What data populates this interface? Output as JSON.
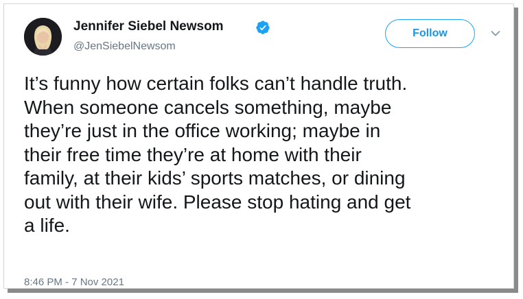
{
  "author": {
    "display_name": "Jennifer Siebel Newsom",
    "handle": "@JenSiebelNewsom",
    "verified": true,
    "avatar_icon": "profile-photo"
  },
  "actions": {
    "follow_label": "Follow",
    "more_icon": "chevron-down-icon"
  },
  "tweet": {
    "lines": [
      "It’s funny how certain folks can’t handle truth.",
      "When someone cancels something, maybe",
      "they’re just in the office working; maybe in",
      "their free time they’re at home with their",
      "family, at their kids’ sports matches, or dining",
      "out with their wife. Please stop hating and get",
      "a life."
    ],
    "timestamp": "8:46 PM - 7 Nov 2021"
  },
  "colors": {
    "accent": "#1da1f2",
    "text": "#14171a",
    "secondary_text": "#657786"
  }
}
